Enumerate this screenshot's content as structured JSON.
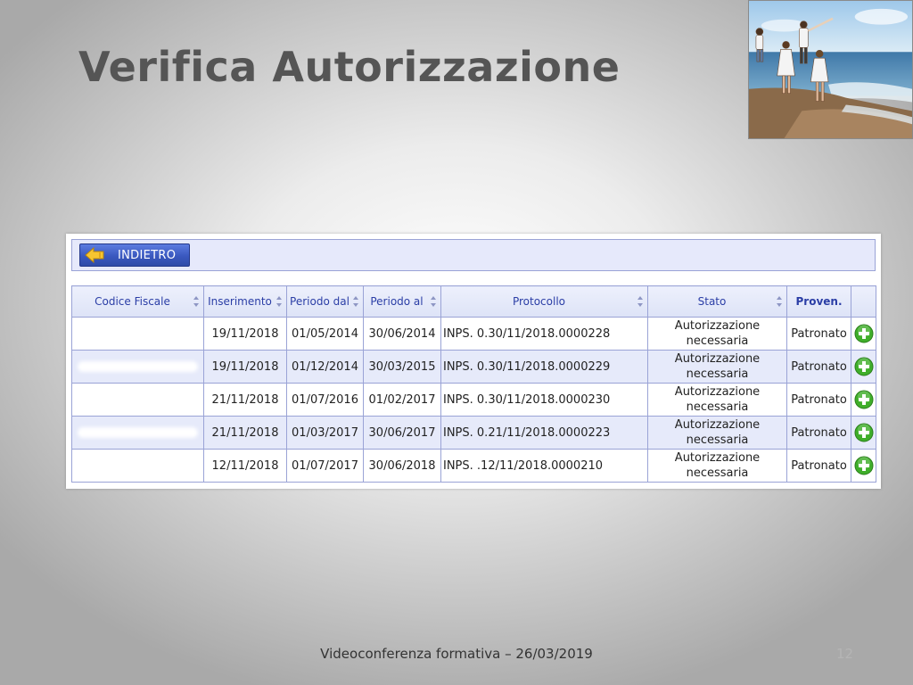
{
  "slide": {
    "title": "Verifica Autorizzazione",
    "footer": "Videoconferenza formativa – 26/03/2019",
    "page_number": "12"
  },
  "toolbar": {
    "back_label": "INDIETRO",
    "back_icon": "arrow-left-icon"
  },
  "table": {
    "headers": {
      "codice_fiscale": "Codice Fiscale",
      "inserimento": "Inserimento",
      "periodo_dal": "Periodo dal",
      "periodo_al": "Periodo al",
      "protocollo": "Protocollo",
      "stato": "Stato",
      "proven": "Proven."
    },
    "rows": [
      {
        "codice_fiscale": "",
        "inserimento": "19/11/2018",
        "periodo_dal": "01/05/2014",
        "periodo_al": "30/06/2014",
        "protocollo": "INPS.    0.30/11/2018.0000228",
        "stato": "Autorizzazione necessaria",
        "proven": "Patronato"
      },
      {
        "codice_fiscale": "",
        "inserimento": "19/11/2018",
        "periodo_dal": "01/12/2014",
        "periodo_al": "30/03/2015",
        "protocollo": "INPS.    0.30/11/2018.0000229",
        "stato": "Autorizzazione necessaria",
        "proven": "Patronato"
      },
      {
        "codice_fiscale": "",
        "inserimento": "21/11/2018",
        "periodo_dal": "01/07/2016",
        "periodo_al": "01/02/2017",
        "protocollo": "INPS.    0.30/11/2018.0000230",
        "stato": "Autorizzazione necessaria",
        "proven": "Patronato"
      },
      {
        "codice_fiscale": "",
        "inserimento": "21/11/2018",
        "periodo_dal": "01/03/2017",
        "periodo_al": "30/06/2017",
        "protocollo": "INPS.    0.21/11/2018.0000223",
        "stato": "Autorizzazione necessaria",
        "proven": "Patronato"
      },
      {
        "codice_fiscale": "",
        "inserimento": "12/11/2018",
        "periodo_dal": "01/07/2017",
        "periodo_al": "30/06/2018",
        "protocollo": "INPS.    .12/11/2018.0000210",
        "stato": "Autorizzazione necessaria",
        "proven": "Patronato"
      }
    ]
  },
  "icons": {
    "row_action": "plus-circle-icon",
    "sort": "sort-arrows-icon",
    "photo": "beach-family-photo"
  },
  "colors": {
    "title": "#555555",
    "header_text": "#2b3ea6",
    "button_blue": "#3a58bf",
    "add_green": "#3fae2a",
    "row_alt": "#e6eafa"
  }
}
